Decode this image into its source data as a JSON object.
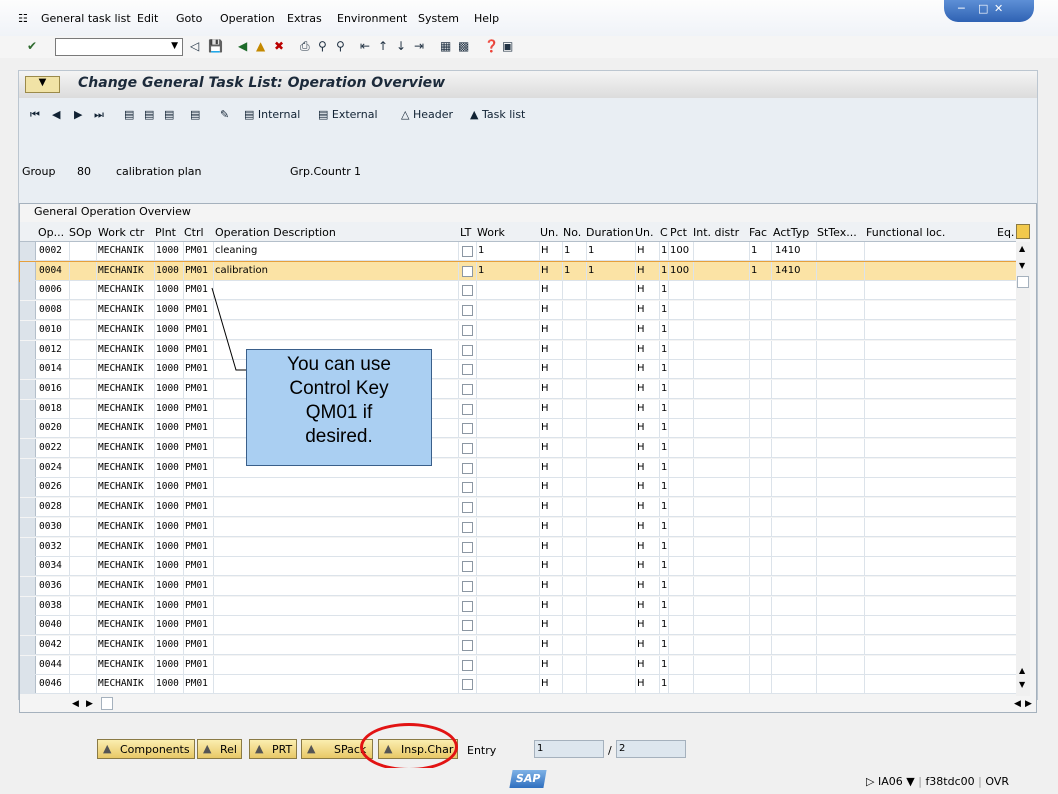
{
  "menu": [
    "General task list",
    "Edit",
    "Goto",
    "Operation",
    "Extras",
    "Environment",
    "System",
    "Help"
  ],
  "title": "Change General Task List: Operation Overview",
  "app_toolbar": {
    "internal": "Internal",
    "external": "External",
    "header": "Header",
    "task_list": "Task list"
  },
  "header": {
    "group_label": "Group",
    "group_value": "80",
    "group_desc": "calibration plan",
    "grp_countr_label": "Grp.Countr",
    "grp_countr_value": "1"
  },
  "table": {
    "title": "General Operation Overview",
    "columns": [
      "Op...",
      "SOp",
      "Work ctr",
      "Plnt",
      "Ctrl",
      "Operation Description",
      "LT",
      "Work",
      "Un.",
      "No.",
      "Duration",
      "Un.",
      "C",
      "Pct",
      "Int. distr",
      "Fac",
      "ActTyp",
      "StTex...",
      "Functional loc.",
      "Eq."
    ],
    "rows": [
      {
        "op": "0002",
        "workctr": "MECHANIK",
        "plnt": "1000",
        "ctrl": "PM01",
        "desc": "cleaning",
        "work": "1",
        "un": "H",
        "no": "1",
        "dur": "1",
        "un2": "H",
        "c": "1",
        "pct": "100",
        "fac": "1",
        "acttyp": "1410"
      },
      {
        "op": "0004",
        "workctr": "MECHANIK",
        "plnt": "1000",
        "ctrl": "PM01",
        "desc": "calibration",
        "work": "1",
        "un": "H",
        "no": "1",
        "dur": "1",
        "un2": "H",
        "c": "1",
        "pct": "100",
        "fac": "1",
        "acttyp": "1410",
        "selected": true
      },
      {
        "op": "0006",
        "workctr": "MECHANIK",
        "plnt": "1000",
        "ctrl": "PM01",
        "un": "H",
        "un2": "H",
        "c": "1"
      },
      {
        "op": "0008",
        "workctr": "MECHANIK",
        "plnt": "1000",
        "ctrl": "PM01",
        "un": "H",
        "un2": "H",
        "c": "1"
      },
      {
        "op": "0010",
        "workctr": "MECHANIK",
        "plnt": "1000",
        "ctrl": "PM01",
        "un": "H",
        "un2": "H",
        "c": "1"
      },
      {
        "op": "0012",
        "workctr": "MECHANIK",
        "plnt": "1000",
        "ctrl": "PM01",
        "un": "H",
        "un2": "H",
        "c": "1"
      },
      {
        "op": "0014",
        "workctr": "MECHANIK",
        "plnt": "1000",
        "ctrl": "PM01",
        "un": "H",
        "un2": "H",
        "c": "1"
      },
      {
        "op": "0016",
        "workctr": "MECHANIK",
        "plnt": "1000",
        "ctrl": "PM01",
        "un": "H",
        "un2": "H",
        "c": "1"
      },
      {
        "op": "0018",
        "workctr": "MECHANIK",
        "plnt": "1000",
        "ctrl": "PM01",
        "un": "H",
        "un2": "H",
        "c": "1"
      },
      {
        "op": "0020",
        "workctr": "MECHANIK",
        "plnt": "1000",
        "ctrl": "PM01",
        "un": "H",
        "un2": "H",
        "c": "1"
      },
      {
        "op": "0022",
        "workctr": "MECHANIK",
        "plnt": "1000",
        "ctrl": "PM01",
        "un": "H",
        "un2": "H",
        "c": "1"
      },
      {
        "op": "0024",
        "workctr": "MECHANIK",
        "plnt": "1000",
        "ctrl": "PM01",
        "un": "H",
        "un2": "H",
        "c": "1"
      },
      {
        "op": "0026",
        "workctr": "MECHANIK",
        "plnt": "1000",
        "ctrl": "PM01",
        "un": "H",
        "un2": "H",
        "c": "1"
      },
      {
        "op": "0028",
        "workctr": "MECHANIK",
        "plnt": "1000",
        "ctrl": "PM01",
        "un": "H",
        "un2": "H",
        "c": "1"
      },
      {
        "op": "0030",
        "workctr": "MECHANIK",
        "plnt": "1000",
        "ctrl": "PM01",
        "un": "H",
        "un2": "H",
        "c": "1"
      },
      {
        "op": "0032",
        "workctr": "MECHANIK",
        "plnt": "1000",
        "ctrl": "PM01",
        "un": "H",
        "un2": "H",
        "c": "1"
      },
      {
        "op": "0034",
        "workctr": "MECHANIK",
        "plnt": "1000",
        "ctrl": "PM01",
        "un": "H",
        "un2": "H",
        "c": "1"
      },
      {
        "op": "0036",
        "workctr": "MECHANIK",
        "plnt": "1000",
        "ctrl": "PM01",
        "un": "H",
        "un2": "H",
        "c": "1"
      },
      {
        "op": "0038",
        "workctr": "MECHANIK",
        "plnt": "1000",
        "ctrl": "PM01",
        "un": "H",
        "un2": "H",
        "c": "1"
      },
      {
        "op": "0040",
        "workctr": "MECHANIK",
        "plnt": "1000",
        "ctrl": "PM01",
        "un": "H",
        "un2": "H",
        "c": "1"
      },
      {
        "op": "0042",
        "workctr": "MECHANIK",
        "plnt": "1000",
        "ctrl": "PM01",
        "un": "H",
        "un2": "H",
        "c": "1"
      },
      {
        "op": "0044",
        "workctr": "MECHANIK",
        "plnt": "1000",
        "ctrl": "PM01",
        "un": "H",
        "un2": "H",
        "c": "1"
      },
      {
        "op": "0046",
        "workctr": "MECHANIK",
        "plnt": "1000",
        "ctrl": "PM01",
        "un": "H",
        "un2": "H",
        "c": "1"
      }
    ]
  },
  "callout": {
    "line1": "You can use",
    "line2": "Control Key",
    "line3": "QM01 if",
    "line4": "desired."
  },
  "bottom_buttons": {
    "components": "Components",
    "rel": "Rel",
    "prt": "PRT",
    "spack": "SPack",
    "insp_char": "Insp.Char"
  },
  "entry": {
    "label": "Entry",
    "current": "1",
    "total": "2",
    "separator": "/"
  },
  "statusbar": {
    "brand": "SAP",
    "transaction": "IA06",
    "server": "f38tdc00",
    "mode": "OVR"
  },
  "colors": {
    "highlight": "#e21313",
    "selected_row": "#fbe3a5",
    "callout_fill": "#aacff2"
  }
}
